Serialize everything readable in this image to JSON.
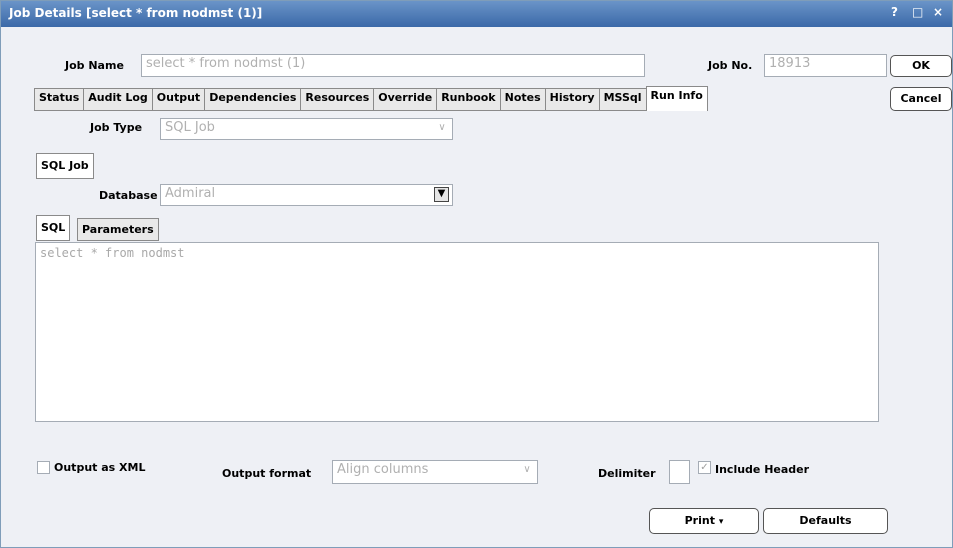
{
  "window": {
    "title": "Job Details [select * from nodmst (1)]",
    "help": "?",
    "maximize": "□",
    "close": "×"
  },
  "header": {
    "job_name_label": "Job Name",
    "job_name_value": "select * from nodmst (1)",
    "job_no_label": "Job No.",
    "job_no_value": "18913"
  },
  "buttons": {
    "ok": "OK",
    "cancel": "Cancel",
    "print": "Print",
    "defaults": "Defaults"
  },
  "tabs": [
    "Status",
    "Audit Log",
    "Output",
    "Dependencies",
    "Resources",
    "Override",
    "Runbook",
    "Notes",
    "History",
    "MSSql",
    "Run Info"
  ],
  "active_tab": "Run Info",
  "job_type": {
    "label": "Job Type",
    "value": "SQL Job"
  },
  "sql_job_tab": "SQL Job",
  "database": {
    "label": "Database",
    "value": "Admiral"
  },
  "sub_tabs": {
    "sql": "SQL",
    "parameters": "Parameters"
  },
  "sql_text": "select * from nodmst",
  "footer": {
    "output_xml_label": "Output as XML",
    "output_xml_checked": false,
    "output_format_label": "Output format",
    "output_format_value": "Align columns",
    "delimiter_label": "Delimiter",
    "delimiter_value": "",
    "include_header_label": "Include Header",
    "include_header_checked": true
  }
}
